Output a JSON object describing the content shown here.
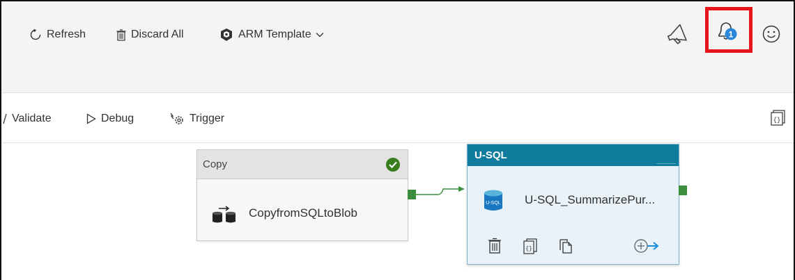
{
  "toolbar": {
    "refresh_label": "Refresh",
    "discard_label": "Discard All",
    "arm_label": "ARM Template",
    "notification_count": "1"
  },
  "subtoolbar": {
    "validate_label": "Validate",
    "debug_label": "Debug",
    "trigger_label": "Trigger"
  },
  "activities": {
    "copy": {
      "type_label": "Copy",
      "name": "CopyfromSQLtoBlob",
      "status": "succeeded"
    },
    "usql": {
      "type_label": "U-SQL",
      "name": "U-SQL_SummarizePur...",
      "icon_text": "U-SQL"
    }
  },
  "colors": {
    "highlight_box": "#e8141c",
    "usql_header": "#0f7c9d",
    "success_port": "#3b8e3b",
    "notification_badge": "#2b88d8"
  }
}
